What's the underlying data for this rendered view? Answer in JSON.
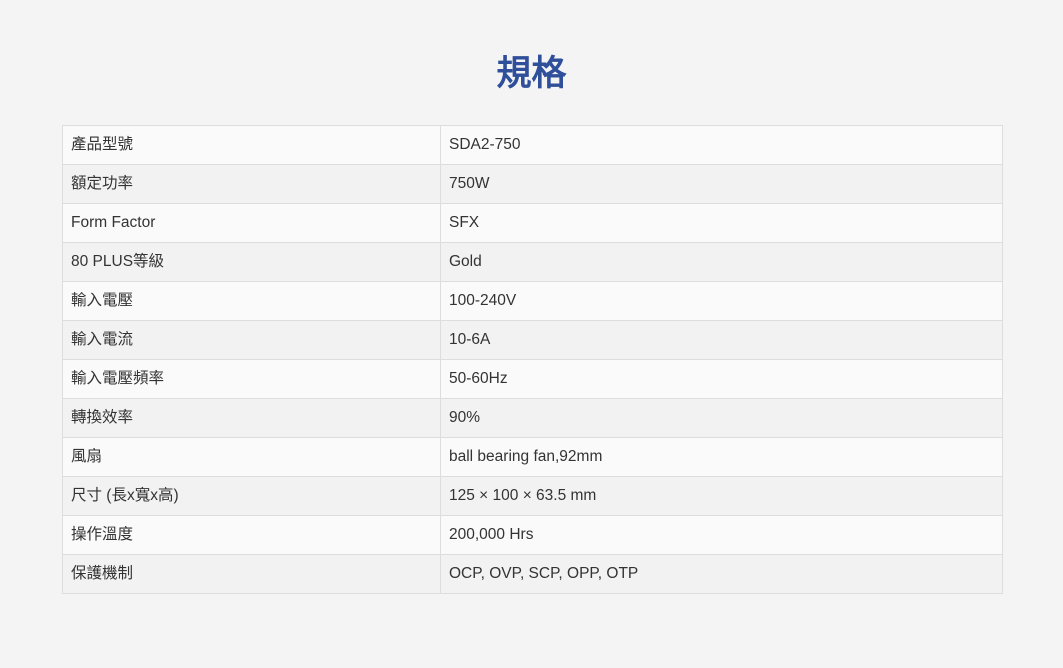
{
  "page": {
    "title": "規格"
  },
  "colors": {
    "title": "#2f4f9a",
    "text": "#333333",
    "background": "#f4f4f4",
    "row_odd": "#fafafa",
    "row_even": "#f2f2f2",
    "border": "#dddddd"
  },
  "specs": [
    {
      "label": "產品型號",
      "value": "SDA2-750"
    },
    {
      "label": "額定功率",
      "value": "750W"
    },
    {
      "label": "Form Factor",
      "value": "SFX"
    },
    {
      "label": "80 PLUS等級",
      "value": "Gold"
    },
    {
      "label": "輸入電壓",
      "value": "100-240V"
    },
    {
      "label": "輸入電流",
      "value": "10-6A"
    },
    {
      "label": "輸入電壓頻率",
      "value": "50-60Hz"
    },
    {
      "label": "轉換效率",
      "value": "90%"
    },
    {
      "label": "風扇",
      "value": "ball bearing fan,92mm"
    },
    {
      "label": "尺寸 (長x寬x高)",
      "value": "125 × 100 × 63.5 mm"
    },
    {
      "label": "操作溫度",
      "value": "200,000 Hrs"
    },
    {
      "label": "保護機制",
      "value": "OCP, OVP, SCP, OPP, OTP"
    }
  ]
}
